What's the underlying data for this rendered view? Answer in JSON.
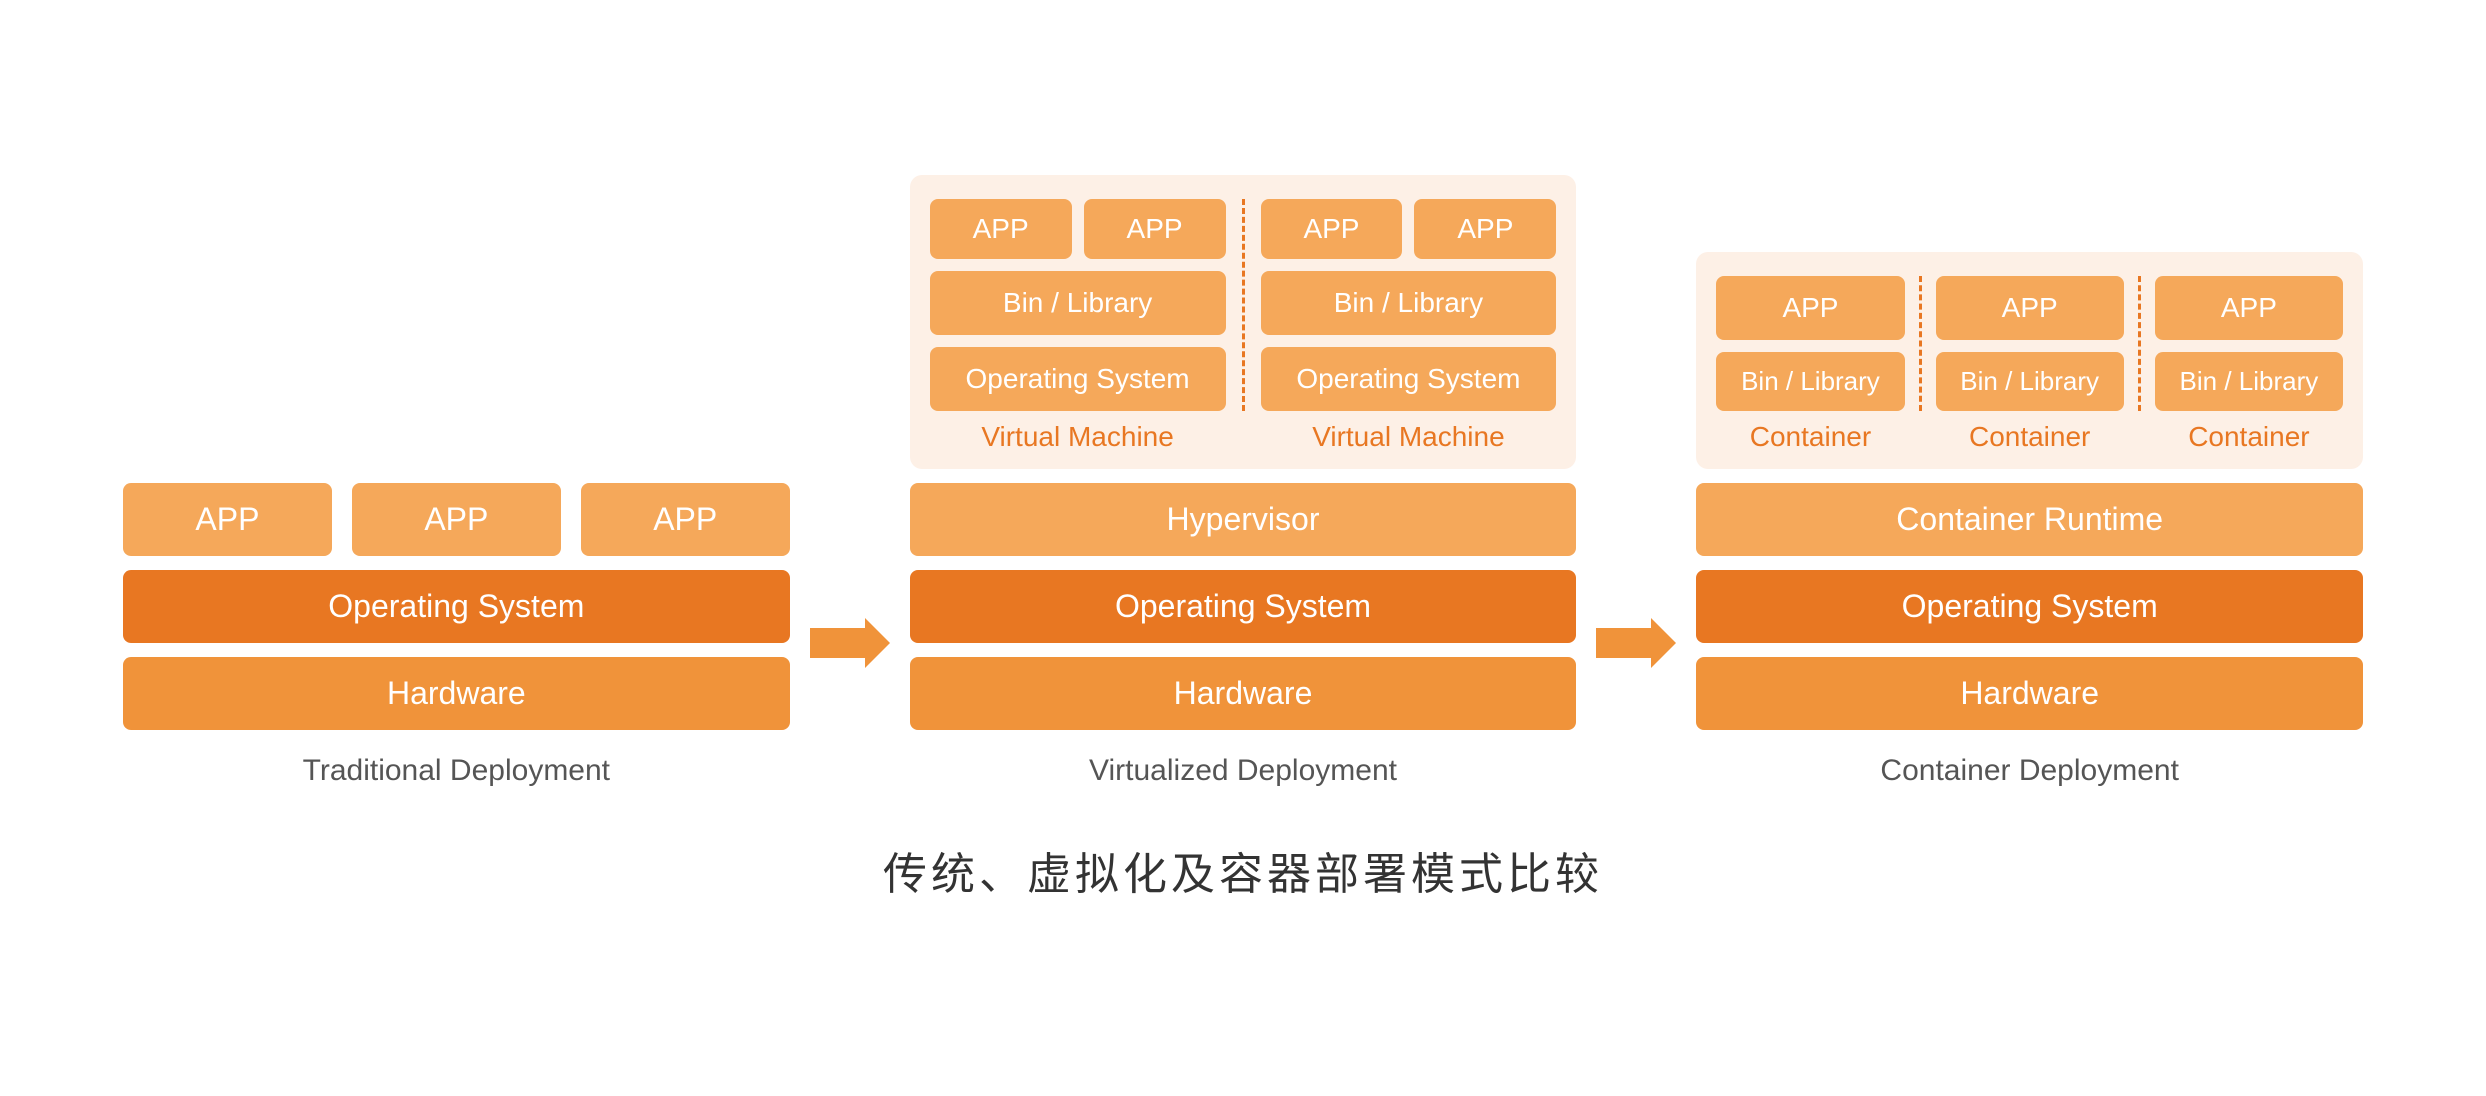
{
  "title": "传统、虚拟化及容器部署模式比较",
  "colors": {
    "orange_dark": "#E87722",
    "orange_mid": "#F0933A",
    "orange_light": "#F5A85A",
    "bg_light": "#FDF0E6",
    "label_orange": "#E87722",
    "text_gray": "#555555"
  },
  "traditional": {
    "apps": [
      "APP",
      "APP",
      "APP"
    ],
    "os": "Operating System",
    "hardware": "Hardware",
    "label": "Traditional Deployment"
  },
  "virtualized": {
    "vm1": {
      "apps": [
        "APP",
        "APP"
      ],
      "bin_library": "Bin / Library",
      "os": "Operating System",
      "label": "Virtual Machine"
    },
    "vm2": {
      "apps": [
        "APP",
        "APP"
      ],
      "bin_library": "Bin / Library",
      "os": "Operating System",
      "label": "Virtual Machine"
    },
    "hypervisor": "Hypervisor",
    "os": "Operating System",
    "hardware": "Hardware",
    "label": "Virtualized Deployment"
  },
  "container": {
    "c1": {
      "app": "APP",
      "bin_library": "Bin / Library",
      "label": "Container"
    },
    "c2": {
      "app": "APP",
      "bin_library": "Bin / Library",
      "label": "Container"
    },
    "c3": {
      "app": "APP",
      "bin_library": "Bin / Library",
      "label": "Container"
    },
    "runtime": "Container Runtime",
    "os": "Operating System",
    "hardware": "Hardware",
    "label": "Container Deployment"
  },
  "arrow": "→"
}
